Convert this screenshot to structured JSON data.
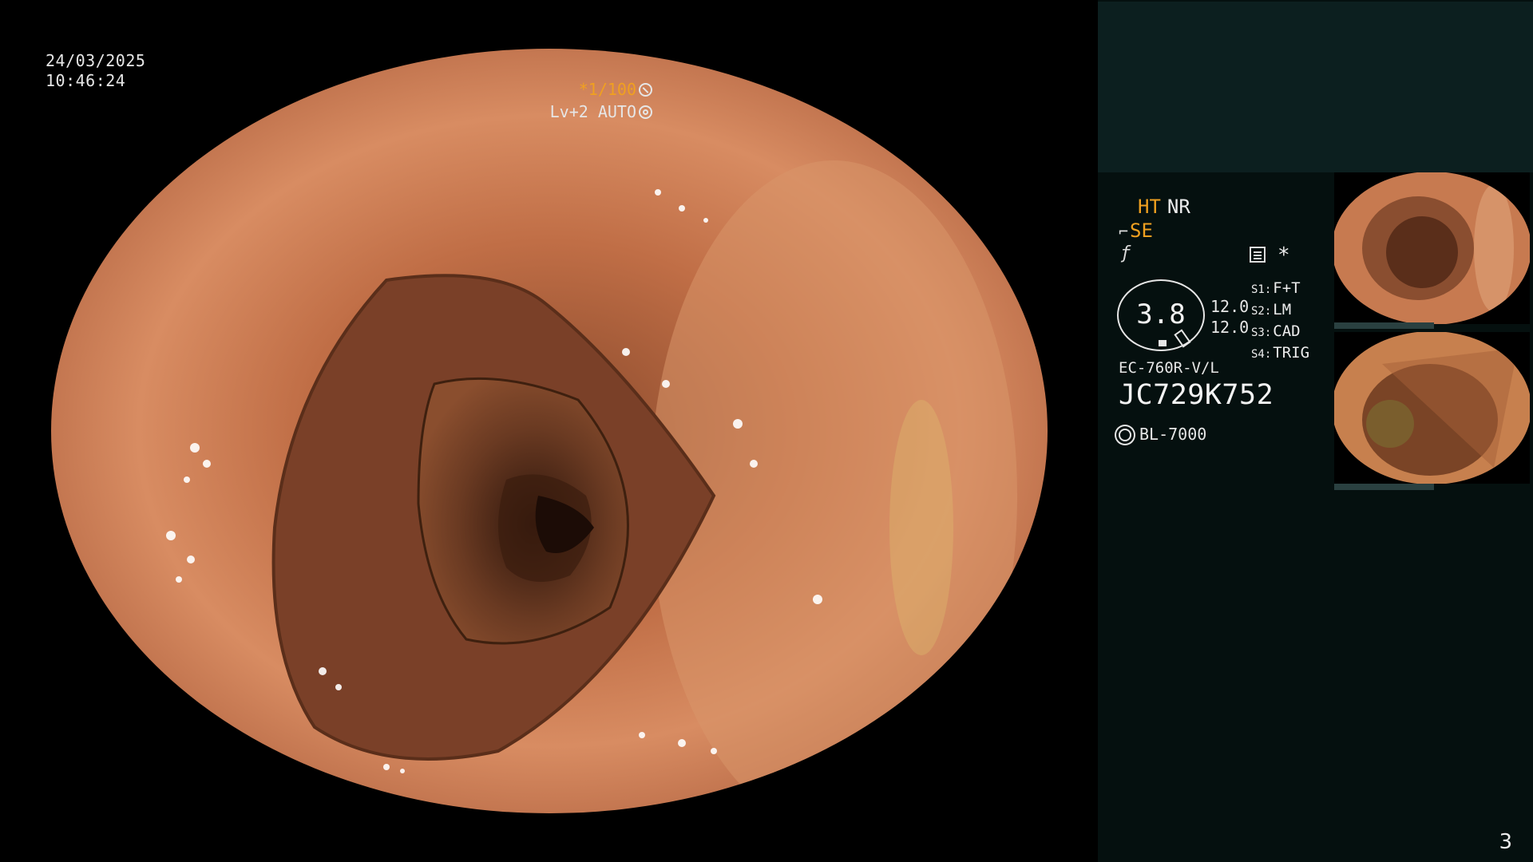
{
  "overlay": {
    "date": "24/03/2025",
    "time": "10:46:24",
    "shutter": "*1/100",
    "brightness": "Lv+2 AUTO"
  },
  "panel": {
    "mode_ht": "HT",
    "mode_nr": "NR",
    "mode_se": "SE",
    "dial_value": "3.8",
    "val1": "12.0",
    "val2": "12.0",
    "switches": [
      {
        "key": "S1:",
        "value": "F+T"
      },
      {
        "key": "S2:",
        "value": "LM"
      },
      {
        "key": "S3:",
        "value": "CAD"
      },
      {
        "key": "S4:",
        "value": "TRIG"
      }
    ],
    "scope_model": "EC-760R-V/L",
    "serial": "JC729K752",
    "light_source": "BL-7000",
    "page_number": "3"
  },
  "colors": {
    "accent": "#f0a020",
    "panel_bg": "#05100f",
    "panel_top": "#0c1f1f",
    "mucosa": "#c8724a"
  },
  "icons": [
    "shutter-icon",
    "auto-icon",
    "pump-icon",
    "fx-icon",
    "menu-icon",
    "star-icon",
    "sun-icon"
  ]
}
